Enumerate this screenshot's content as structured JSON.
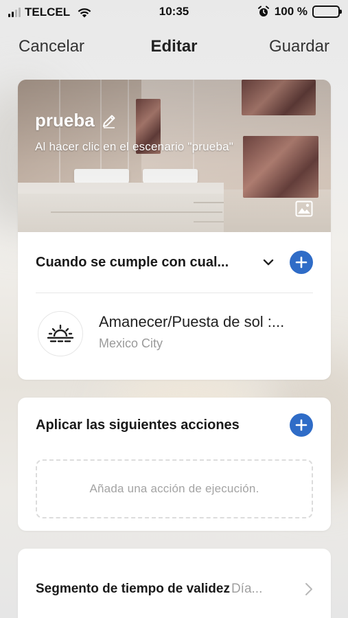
{
  "status_bar": {
    "carrier": "TELCEL",
    "time": "10:35",
    "battery": "100 %",
    "signal_bars_active": 2
  },
  "nav": {
    "cancel_label": "Cancelar",
    "title": "Editar",
    "save_label": "Guardar"
  },
  "scene": {
    "name": "prueba",
    "description": "Al hacer clic en el escenario \"prueba\"",
    "icons": [
      "pencil-icon",
      "image-icon"
    ]
  },
  "conditions": {
    "title": "Cuando se cumple con cual...",
    "items": [
      {
        "icon": "sunrise-icon",
        "title": "Amanecer/Puesta de sol :...",
        "subtitle": "Mexico City"
      }
    ]
  },
  "actions": {
    "title": "Aplicar las siguientes acciones",
    "placeholder": "Añada una acción de ejecución."
  },
  "validity": {
    "label": "Segmento de tiempo de validez",
    "value": "Día..."
  },
  "colors": {
    "accent": "#2f6cc7",
    "text": "#1a1a1a",
    "muted": "#9a9a9a"
  }
}
